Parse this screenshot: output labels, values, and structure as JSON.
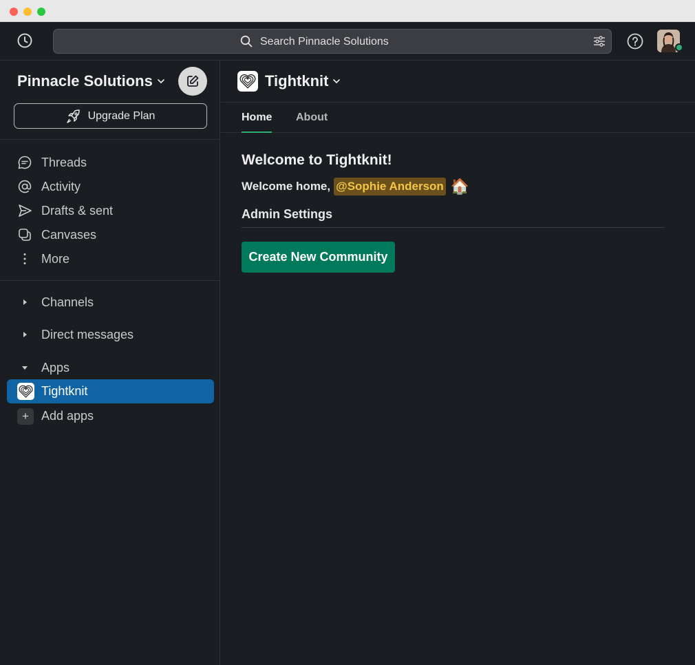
{
  "search": {
    "placeholder": "Search Pinnacle Solutions"
  },
  "workspace": {
    "name": "Pinnacle Solutions",
    "upgrade_label": "Upgrade Plan"
  },
  "nav": {
    "items": [
      {
        "label": "Threads",
        "icon": "threads-icon"
      },
      {
        "label": "Activity",
        "icon": "at-icon"
      },
      {
        "label": "Drafts & sent",
        "icon": "send-icon"
      },
      {
        "label": "Canvases",
        "icon": "canvas-icon"
      },
      {
        "label": "More",
        "icon": "more-vertical-icon"
      }
    ]
  },
  "sections": {
    "channels": "Channels",
    "direct_messages": "Direct messages",
    "apps": "Apps"
  },
  "apps": {
    "active": "Tightknit",
    "add": "Add apps"
  },
  "main": {
    "title": "Tightknit",
    "tabs": [
      {
        "label": "Home",
        "active": true
      },
      {
        "label": "About",
        "active": false
      }
    ],
    "welcome_title": "Welcome to Tightknit!",
    "welcome_prefix": "Welcome home,",
    "mention": "@Sophie Anderson",
    "admin_title": "Admin Settings",
    "create_button": "Create New Community"
  },
  "colors": {
    "accent": "#1164a3",
    "primary_button": "#007a5a",
    "presence": "#2bac76",
    "mention_bg": "#6b4f1c",
    "mention_text": "#f2c744"
  }
}
